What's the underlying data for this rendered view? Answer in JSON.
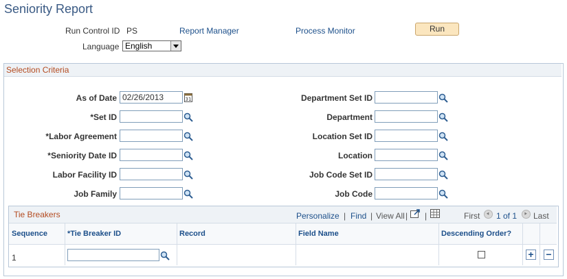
{
  "page": {
    "title": "Seniority Report"
  },
  "header": {
    "run_control_label": "Run Control ID",
    "run_control_value": "PS",
    "report_manager": "Report Manager",
    "process_monitor": "Process Monitor",
    "run_button": "Run",
    "language_label": "Language",
    "language_value": "English"
  },
  "selection": {
    "title": "Selection Criteria",
    "as_of_date_label": "As of Date",
    "as_of_date_value": "02/26/2013",
    "set_id_label": "*Set ID",
    "labor_agreement_label": "*Labor Agreement",
    "seniority_date_id_label": "*Seniority Date ID",
    "labor_facility_id_label": "Labor Facility ID",
    "job_family_label": "Job Family",
    "department_set_id_label": "Department Set ID",
    "department_label": "Department",
    "location_set_id_label": "Location Set ID",
    "location_label": "Location",
    "job_code_set_id_label": "Job Code Set ID",
    "job_code_label": "Job Code"
  },
  "tie_breakers": {
    "title": "Tie Breakers",
    "personalize": "Personalize",
    "separator": "|",
    "find": "Find",
    "view_all": "View All",
    "first": "First",
    "range": "1 of 1",
    "last": "Last",
    "columns": {
      "sequence": "Sequence",
      "tie_breaker_id": "*Tie Breaker ID",
      "record": "Record",
      "field_name": "Field Name",
      "descending": "Descending Order?"
    },
    "rows": [
      {
        "sequence": "1",
        "tie_breaker_id": "",
        "record": "",
        "field_name": "",
        "descending": false
      }
    ],
    "add_symbol": "+",
    "delete_symbol": "−"
  }
}
